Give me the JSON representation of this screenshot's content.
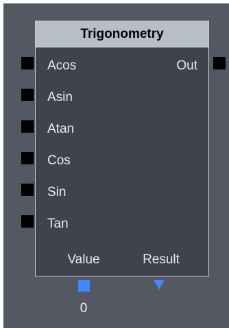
{
  "node": {
    "title": "Trigonometry",
    "inputs": [
      "Acos",
      "Asin",
      "Atan",
      "Cos",
      "Sin",
      "Tan"
    ],
    "outputs": [
      "Out"
    ],
    "bottom_labels": {
      "left": "Value",
      "right": "Result"
    },
    "value": "0"
  },
  "colors": {
    "canvas": "#535862",
    "node_body": "#3e434c",
    "title_bar": "#b8bec8",
    "pin": "#000000",
    "accent": "#3f89ff"
  }
}
